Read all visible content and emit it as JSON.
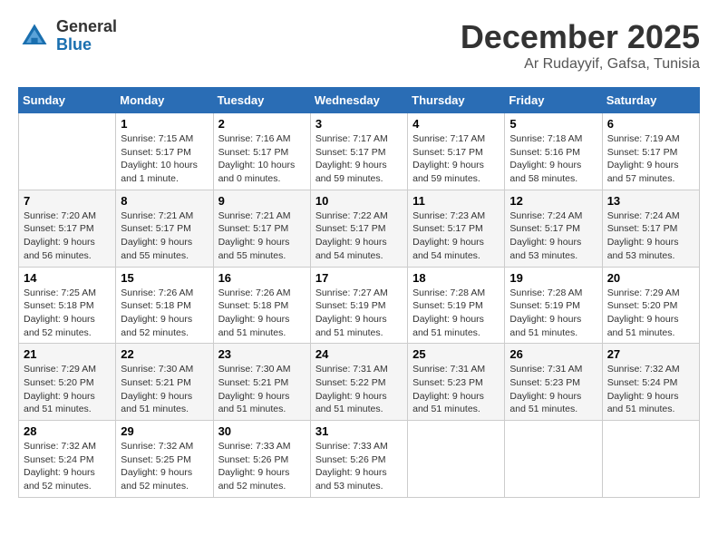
{
  "header": {
    "logo_general": "General",
    "logo_blue": "Blue",
    "month_title": "December 2025",
    "location": "Ar Rudayyif, Gafsa, Tunisia"
  },
  "columns": [
    "Sunday",
    "Monday",
    "Tuesday",
    "Wednesday",
    "Thursday",
    "Friday",
    "Saturday"
  ],
  "weeks": [
    [
      {
        "day": "",
        "info": ""
      },
      {
        "day": "1",
        "info": "Sunrise: 7:15 AM\nSunset: 5:17 PM\nDaylight: 10 hours\nand 1 minute."
      },
      {
        "day": "2",
        "info": "Sunrise: 7:16 AM\nSunset: 5:17 PM\nDaylight: 10 hours\nand 0 minutes."
      },
      {
        "day": "3",
        "info": "Sunrise: 7:17 AM\nSunset: 5:17 PM\nDaylight: 9 hours\nand 59 minutes."
      },
      {
        "day": "4",
        "info": "Sunrise: 7:17 AM\nSunset: 5:17 PM\nDaylight: 9 hours\nand 59 minutes."
      },
      {
        "day": "5",
        "info": "Sunrise: 7:18 AM\nSunset: 5:16 PM\nDaylight: 9 hours\nand 58 minutes."
      },
      {
        "day": "6",
        "info": "Sunrise: 7:19 AM\nSunset: 5:17 PM\nDaylight: 9 hours\nand 57 minutes."
      }
    ],
    [
      {
        "day": "7",
        "info": "Sunrise: 7:20 AM\nSunset: 5:17 PM\nDaylight: 9 hours\nand 56 minutes."
      },
      {
        "day": "8",
        "info": "Sunrise: 7:21 AM\nSunset: 5:17 PM\nDaylight: 9 hours\nand 55 minutes."
      },
      {
        "day": "9",
        "info": "Sunrise: 7:21 AM\nSunset: 5:17 PM\nDaylight: 9 hours\nand 55 minutes."
      },
      {
        "day": "10",
        "info": "Sunrise: 7:22 AM\nSunset: 5:17 PM\nDaylight: 9 hours\nand 54 minutes."
      },
      {
        "day": "11",
        "info": "Sunrise: 7:23 AM\nSunset: 5:17 PM\nDaylight: 9 hours\nand 54 minutes."
      },
      {
        "day": "12",
        "info": "Sunrise: 7:24 AM\nSunset: 5:17 PM\nDaylight: 9 hours\nand 53 minutes."
      },
      {
        "day": "13",
        "info": "Sunrise: 7:24 AM\nSunset: 5:17 PM\nDaylight: 9 hours\nand 53 minutes."
      }
    ],
    [
      {
        "day": "14",
        "info": "Sunrise: 7:25 AM\nSunset: 5:18 PM\nDaylight: 9 hours\nand 52 minutes."
      },
      {
        "day": "15",
        "info": "Sunrise: 7:26 AM\nSunset: 5:18 PM\nDaylight: 9 hours\nand 52 minutes."
      },
      {
        "day": "16",
        "info": "Sunrise: 7:26 AM\nSunset: 5:18 PM\nDaylight: 9 hours\nand 51 minutes."
      },
      {
        "day": "17",
        "info": "Sunrise: 7:27 AM\nSunset: 5:19 PM\nDaylight: 9 hours\nand 51 minutes."
      },
      {
        "day": "18",
        "info": "Sunrise: 7:28 AM\nSunset: 5:19 PM\nDaylight: 9 hours\nand 51 minutes."
      },
      {
        "day": "19",
        "info": "Sunrise: 7:28 AM\nSunset: 5:19 PM\nDaylight: 9 hours\nand 51 minutes."
      },
      {
        "day": "20",
        "info": "Sunrise: 7:29 AM\nSunset: 5:20 PM\nDaylight: 9 hours\nand 51 minutes."
      }
    ],
    [
      {
        "day": "21",
        "info": "Sunrise: 7:29 AM\nSunset: 5:20 PM\nDaylight: 9 hours\nand 51 minutes."
      },
      {
        "day": "22",
        "info": "Sunrise: 7:30 AM\nSunset: 5:21 PM\nDaylight: 9 hours\nand 51 minutes."
      },
      {
        "day": "23",
        "info": "Sunrise: 7:30 AM\nSunset: 5:21 PM\nDaylight: 9 hours\nand 51 minutes."
      },
      {
        "day": "24",
        "info": "Sunrise: 7:31 AM\nSunset: 5:22 PM\nDaylight: 9 hours\nand 51 minutes."
      },
      {
        "day": "25",
        "info": "Sunrise: 7:31 AM\nSunset: 5:23 PM\nDaylight: 9 hours\nand 51 minutes."
      },
      {
        "day": "26",
        "info": "Sunrise: 7:31 AM\nSunset: 5:23 PM\nDaylight: 9 hours\nand 51 minutes."
      },
      {
        "day": "27",
        "info": "Sunrise: 7:32 AM\nSunset: 5:24 PM\nDaylight: 9 hours\nand 51 minutes."
      }
    ],
    [
      {
        "day": "28",
        "info": "Sunrise: 7:32 AM\nSunset: 5:24 PM\nDaylight: 9 hours\nand 52 minutes."
      },
      {
        "day": "29",
        "info": "Sunrise: 7:32 AM\nSunset: 5:25 PM\nDaylight: 9 hours\nand 52 minutes."
      },
      {
        "day": "30",
        "info": "Sunrise: 7:33 AM\nSunset: 5:26 PM\nDaylight: 9 hours\nand 52 minutes."
      },
      {
        "day": "31",
        "info": "Sunrise: 7:33 AM\nSunset: 5:26 PM\nDaylight: 9 hours\nand 53 minutes."
      },
      {
        "day": "",
        "info": ""
      },
      {
        "day": "",
        "info": ""
      },
      {
        "day": "",
        "info": ""
      }
    ]
  ]
}
